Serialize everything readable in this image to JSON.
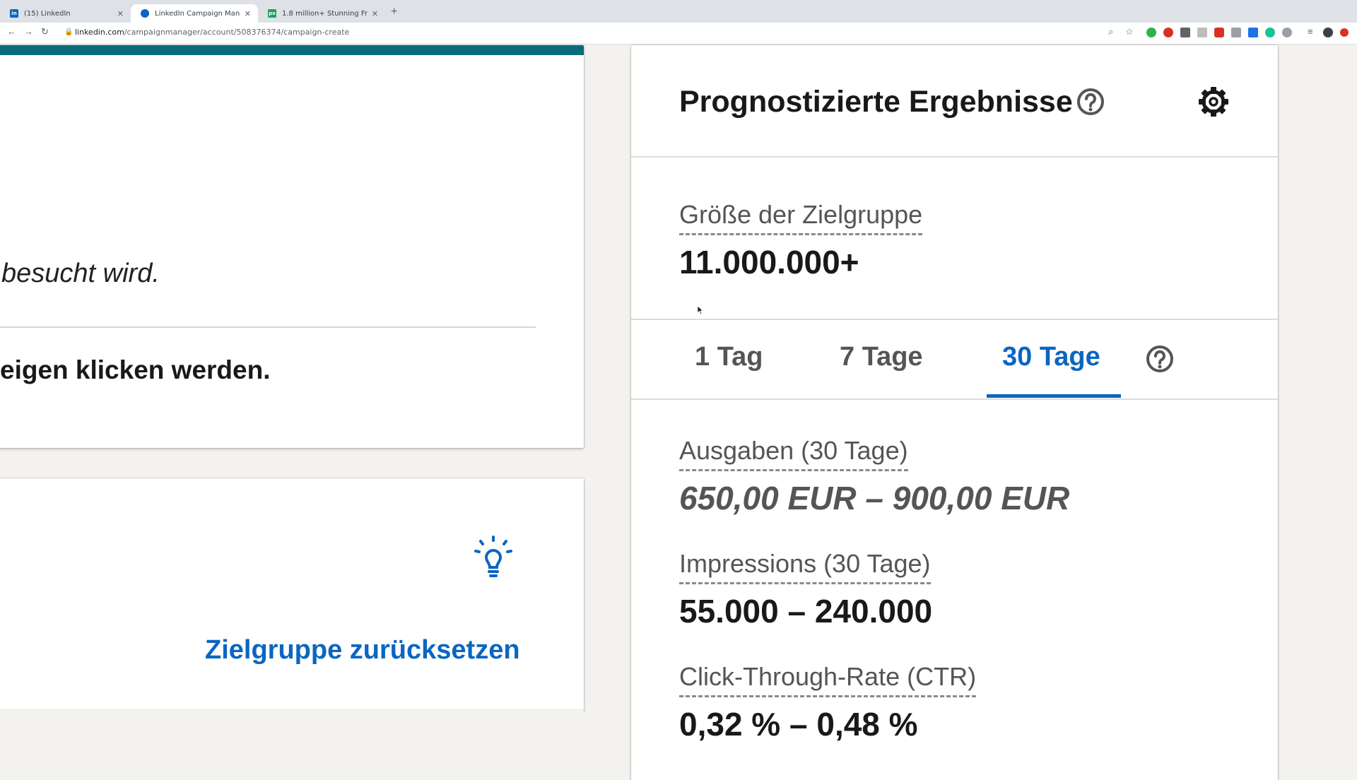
{
  "browser": {
    "tabs": [
      {
        "title": "(15) LinkedIn",
        "active": false,
        "favicon_color": "#0a66c2"
      },
      {
        "title": "LinkedIn Campaign Manager",
        "active": true,
        "favicon_color": "#0a66c2"
      },
      {
        "title": "1.8 million+ Stunning Free Ima...",
        "active": false,
        "favicon_color": "#1aa260"
      }
    ],
    "new_tab_label": "+",
    "url_host": "linkedin.com",
    "url_path": "/campaignmanager/account/508376374/campaign-create"
  },
  "left_top": {
    "text_visited": "besucht wird.",
    "text_clicks": "eigen klicken werden.",
    "accent_bar_color": "#0a6b7a"
  },
  "left_bottom": {
    "reset_link": "Zielgruppe zurücksetzen",
    "bulb_icon": "lightbulb-icon"
  },
  "forecast": {
    "title": "Prognostizierte Ergebnisse",
    "audience_label": "Größe der Zielgruppe",
    "audience_value": "11.000.000+",
    "tabs": [
      "1 Tag",
      "7 Tage",
      "30 Tage"
    ],
    "selected_tab": "30 Tage",
    "spend_label": "Ausgaben (30 Tage)",
    "spend_value": "650,00 EUR – 900,00 EUR",
    "impressions_label": "Impressions (30 Tage)",
    "impressions_value": "55.000 – 240.000",
    "ctr_label": "Click-Through-Rate (CTR)",
    "ctr_value": "0,32 % – 0,48 %"
  },
  "colors": {
    "brand_blue": "#0a66c2",
    "text_dark": "#191919",
    "text_muted": "#555555"
  }
}
